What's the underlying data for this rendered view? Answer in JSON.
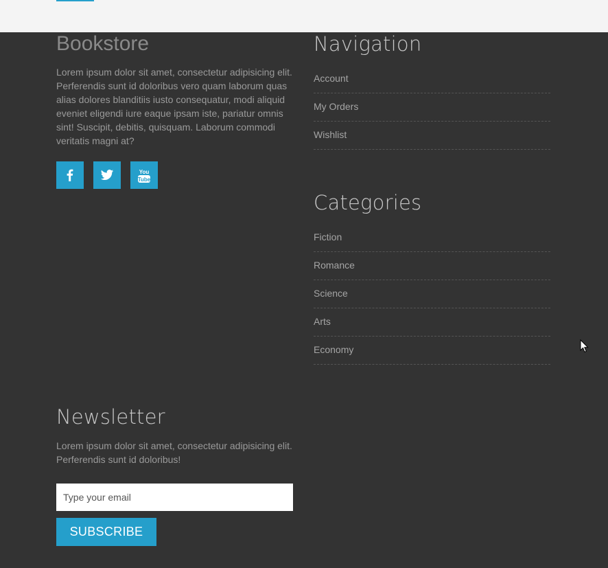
{
  "brand": {
    "title": "Bookstore",
    "description": "Lorem ipsum dolor sit amet, consectetur adipisicing elit. Perferendis sunt id doloribus vero quam laborum quas alias dolores blanditiis iusto consequatur, modi aliquid eveniet eligendi iure eaque ipsam iste, pariatur omnis sint! Suscipit, debitis, quisquam. Laborum commodi veritatis magni at?"
  },
  "social": [
    {
      "name": "facebook-icon",
      "glyph": "f"
    },
    {
      "name": "twitter-icon"
    },
    {
      "name": "youtube-icon",
      "glyph_top": "You",
      "glyph_bottom": "Tube"
    }
  ],
  "navigation": {
    "title": "Navigation",
    "items": [
      "Account",
      "My Orders",
      "Wishlist"
    ]
  },
  "categories": {
    "title": "Categories",
    "items": [
      "Fiction",
      "Romance",
      "Science",
      "Arts",
      "Economy"
    ]
  },
  "newsletter": {
    "title": "Newsletter",
    "description": "Lorem ipsum dolor sit amet, consectetur adipisicing elit. Perferendis sunt id doloribus!",
    "email_placeholder": "Type your email",
    "button_label": "SUBSCRIBE"
  },
  "colors": {
    "accent": "#259fcb",
    "footer_bg": "#333333",
    "topbar_bg": "#f4f4f4"
  }
}
